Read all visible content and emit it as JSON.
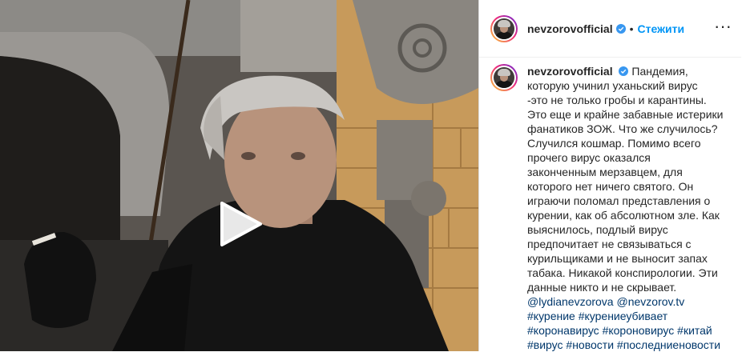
{
  "post": {
    "username": "nevzorovofficial",
    "follow_label": "Стежити",
    "dot": "•",
    "more_label": "···",
    "caption_lines": [
      "Пандемия,",
      "которую учинил уханьский вирус",
      "-это не только гробы и карантины.",
      "Это еще и крайне забавные истерики",
      "фанатиков ЗОЖ. Что же случилось?",
      "Случился кошмар. Помимо всего",
      "прочего вирус оказался",
      "законченным мерзавцем, для",
      "которого нет ничего святого. Он",
      "играючи поломал представления о",
      "курении, как об абсолютном зле. Как",
      "выяснилось, подлый вирус",
      "предпочитает не связываться с",
      "курильщиками и не выносит запах",
      "табака. Никакой конспирологии. Эти",
      "данные никто и не скрывает."
    ],
    "mentions": [
      "@lydianevzorova",
      "@nevzorov.tv"
    ],
    "hashtag_lines": [
      [
        "#курение",
        "#курениеубивает"
      ],
      [
        "#коронавирус",
        "#короновирус",
        "#китай"
      ],
      [
        "#вирус",
        "#новости",
        "#последниеновости"
      ]
    ]
  },
  "colors": {
    "link": "#00376b",
    "follow": "#0095f6",
    "verified": "#3897f0",
    "text": "#262626"
  },
  "icons": {
    "play": "play-icon",
    "verified": "verified-badge-icon",
    "more": "more-options-icon"
  }
}
